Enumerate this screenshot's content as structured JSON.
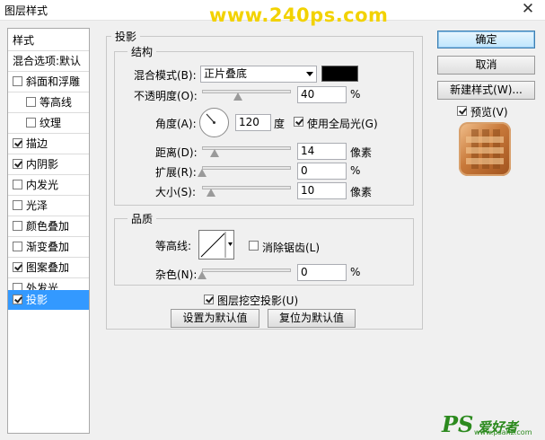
{
  "window": {
    "title": "图层样式",
    "watermark_top": "www.240ps.com"
  },
  "sidebar": {
    "items": [
      {
        "label": "样式"
      },
      {
        "label": "混合选项:默认"
      },
      {
        "label": "斜面和浮雕",
        "checked": false
      },
      {
        "label": "等高线",
        "checked": false
      },
      {
        "label": "纹理",
        "checked": false
      },
      {
        "label": "描边",
        "checked": true
      },
      {
        "label": "内阴影",
        "checked": true
      },
      {
        "label": "内发光",
        "checked": false
      },
      {
        "label": "光泽",
        "checked": false
      },
      {
        "label": "颜色叠加",
        "checked": false
      },
      {
        "label": "渐变叠加",
        "checked": false
      },
      {
        "label": "图案叠加",
        "checked": true
      },
      {
        "label": "外发光",
        "checked": false
      },
      {
        "label": "投影",
        "checked": true,
        "selected": true
      }
    ]
  },
  "main": {
    "section_title": "投影",
    "structure": {
      "title": "结构",
      "blend_mode_label": "混合模式(B):",
      "blend_mode_value": "正片叠底",
      "shadow_color": "#000000",
      "opacity_label": "不透明度(O):",
      "opacity_value": "40",
      "opacity_unit": "%",
      "opacity_slider": 0.4,
      "angle_label": "角度(A):",
      "angle_value": "120",
      "angle_unit": "度",
      "global_light_label": "使用全局光(G)",
      "global_light_checked": true,
      "distance_label": "距离(D):",
      "distance_value": "14",
      "distance_unit": "像素",
      "distance_slider": 0.14,
      "spread_label": "扩展(R):",
      "spread_value": "0",
      "spread_unit": "%",
      "spread_slider": 0,
      "size_label": "大小(S):",
      "size_value": "10",
      "size_unit": "像素",
      "size_slider": 0.1
    },
    "quality": {
      "title": "品质",
      "contour_label": "等高线:",
      "antialias_label": "消除锯齿(L)",
      "antialias_checked": false,
      "noise_label": "杂色(N):",
      "noise_value": "0",
      "noise_unit": "%",
      "noise_slider": 0
    },
    "knockout_label": "图层挖空投影(U)",
    "knockout_checked": true,
    "make_default_label": "设置为默认值",
    "reset_default_label": "复位为默认值"
  },
  "right": {
    "ok_label": "确定",
    "cancel_label": "取消",
    "new_style_label": "新建样式(W)...",
    "preview_label": "预览(V)",
    "preview_checked": true
  },
  "footer": {
    "watermark_logo": "PS",
    "watermark_text": "爱好者",
    "watermark_url": "www.psahz.com"
  }
}
